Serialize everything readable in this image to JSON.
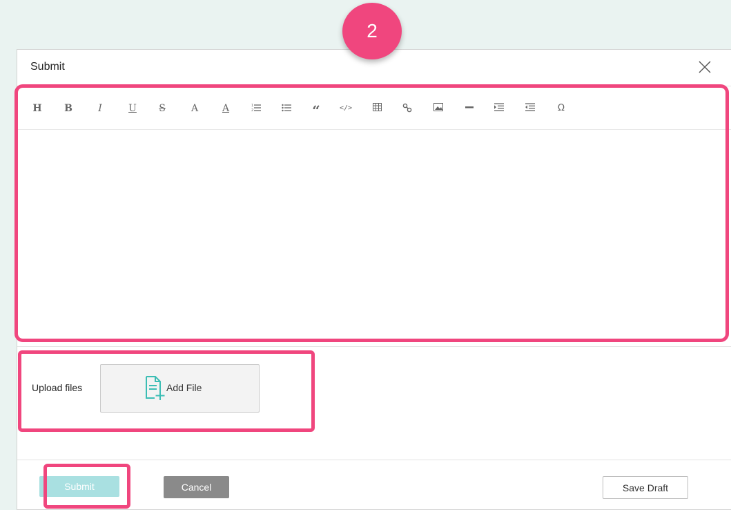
{
  "step": {
    "number": "2",
    "color": "#f0467e"
  },
  "dialog": {
    "title": "Submit",
    "close_icon": "close-icon"
  },
  "editor": {
    "toolbar": [
      {
        "name": "heading",
        "glyph": "H",
        "icon": "heading-icon"
      },
      {
        "name": "bold",
        "glyph": "B",
        "icon": "bold-icon"
      },
      {
        "name": "italic",
        "glyph": "I",
        "icon": "italic-icon"
      },
      {
        "name": "underline",
        "glyph": "U",
        "icon": "underline-icon"
      },
      {
        "name": "strikethrough",
        "glyph": "S",
        "icon": "strikethrough-icon"
      },
      {
        "name": "font-color",
        "glyph": "A",
        "icon": "font-color-icon"
      },
      {
        "name": "background-color",
        "glyph": "A",
        "icon": "background-color-icon"
      },
      {
        "name": "ordered-list",
        "icon": "ordered-list-icon"
      },
      {
        "name": "unordered-list",
        "icon": "unordered-list-icon"
      },
      {
        "name": "quote",
        "glyph": "“",
        "icon": "quote-icon"
      },
      {
        "name": "code",
        "glyph": "</>",
        "icon": "code-icon"
      },
      {
        "name": "table",
        "icon": "table-icon"
      },
      {
        "name": "link",
        "icon": "link-icon"
      },
      {
        "name": "image",
        "icon": "image-icon"
      },
      {
        "name": "horizontal-rule",
        "icon": "horizontal-rule-icon"
      },
      {
        "name": "indent",
        "icon": "indent-icon"
      },
      {
        "name": "outdent",
        "icon": "outdent-icon"
      },
      {
        "name": "special-char",
        "glyph": "Ω",
        "icon": "omega-icon"
      }
    ],
    "content": ""
  },
  "upload": {
    "label": "Upload files",
    "button_label": "Add File",
    "button_icon": "file-add-icon",
    "accent": "#3bbdb4"
  },
  "footer": {
    "submit_label": "Submit",
    "cancel_label": "Cancel",
    "save_draft_label": "Save Draft",
    "submit_color": "#a9e0e1",
    "cancel_color": "#8a8a8a"
  },
  "highlight_color": "#f0467e"
}
